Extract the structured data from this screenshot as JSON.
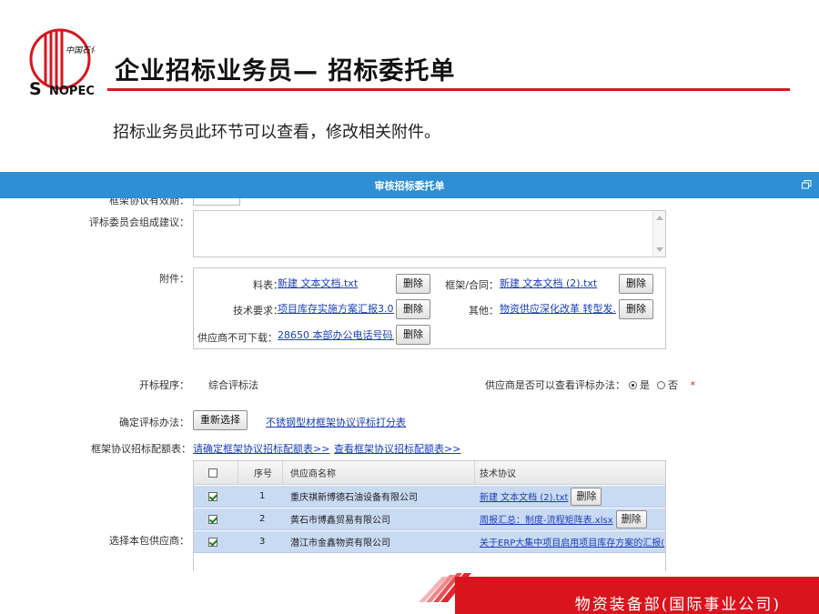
{
  "brand": {
    "logo_text": "中国石化",
    "logo_word": "SINOPEC",
    "accent_color": "#d8161e",
    "window_color": "#2e8ed6"
  },
  "slide": {
    "title": "企业招标业务员— 招标委托单",
    "subtitle": "招标业务员此环节可以查看，修改相关附件。"
  },
  "window": {
    "title": "审核招标委托单",
    "restore_icon": "restore-window-icon"
  },
  "form": {
    "cut_off_label": "框架协议有效期：",
    "committee_label": "评标委员会组成建议：",
    "committee_value": "",
    "attachments_label": "附件：",
    "attachments": {
      "material_label": "料表：",
      "material_file": "新建 文本文档.txt",
      "contract_label": "框架/合同：",
      "contract_file": "新建 文本文档 (2).txt",
      "tech_label": "技术要求：",
      "tech_file": "项目库存实施方案汇报3.0...",
      "other_label": "其他：",
      "other_file": "物资供应深化改革 转型发...",
      "nodl_label": "供应商不可下载：",
      "nodl_file": "28650 本部办公电话号码...",
      "delete_label": "删除"
    },
    "bid_open_label": "开标程序：",
    "bid_open_value": "综合评标法",
    "view_method_label": "供应商是否可以查看评标办法：",
    "view_yes": "是",
    "view_no": "否",
    "view_selected": "是",
    "required_mark": "*",
    "eval_label": "确定评标办法：",
    "reselect_button": "重新选择",
    "eval_link": "不锈钢型材框架协议评标打分表",
    "alloc_label": "框架协议招标配额表：",
    "alloc_link_confirm": "请确定框架协议招标配额表>>",
    "alloc_link_view": "查看框架协议招标配额表>>",
    "suppliers_label": "选择本包供应商：",
    "table": {
      "headers": [
        "序号",
        "供应商名称",
        "技术协议"
      ],
      "rows": [
        {
          "no": "1",
          "name": "重庆祺新博德石油设备有限公司",
          "tech": "新建 文本文档 (2).txt",
          "has_delete": true,
          "checked": true
        },
        {
          "no": "2",
          "name": "黄石市博鑫贸易有限公司",
          "tech": "周报汇总：制度-流程矩阵表.xlsx",
          "has_delete": true,
          "checked": true
        },
        {
          "no": "3",
          "name": "潜江市金鑫物资有限公司",
          "tech": "关于ERP大集中项目启用项目库存方案的汇报(",
          "has_delete": false,
          "checked": true
        }
      ],
      "delete_label": "删除"
    }
  },
  "footer": {
    "department": "物资装备部(国际事业公司)",
    "bar_color": "#d9141c"
  }
}
